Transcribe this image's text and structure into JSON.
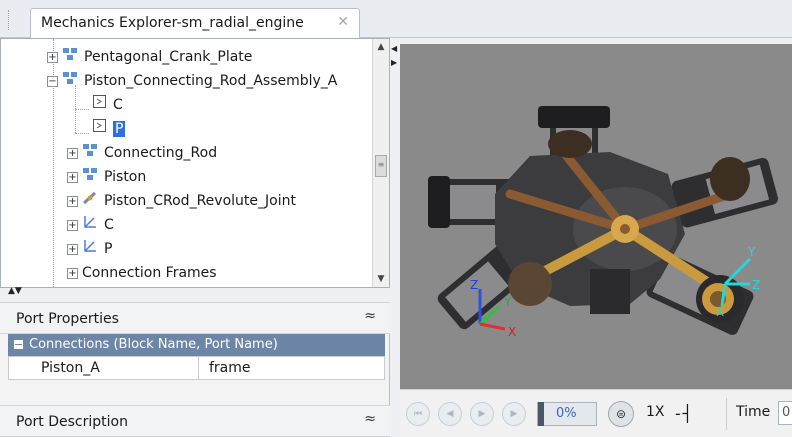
{
  "tab": {
    "title": "Mechanics Explorer-sm_radial_engine",
    "close_glyph": "✕"
  },
  "tree": {
    "items": [
      {
        "label": "Pentagonal_Crank_Plate",
        "icon": "subsystem-icon",
        "expander": "+"
      },
      {
        "label": "Piston_Connecting_Rod_Assembly_A",
        "icon": "subsystem-icon",
        "expander": "−"
      },
      {
        "label": "C",
        "icon": "port-icon",
        "expander": ""
      },
      {
        "label": "P",
        "icon": "port-icon",
        "expander": "",
        "selected": true
      },
      {
        "label": "Connecting_Rod",
        "icon": "subsystem-icon",
        "expander": "+"
      },
      {
        "label": "Piston",
        "icon": "subsystem-icon",
        "expander": "+"
      },
      {
        "label": "Piston_CRod_Revolute_Joint",
        "icon": "joint-icon",
        "expander": "+"
      },
      {
        "label": "C",
        "icon": "frame-icon",
        "expander": "+"
      },
      {
        "label": "P",
        "icon": "frame-icon",
        "expander": "+"
      },
      {
        "label": "Connection Frames",
        "icon": "",
        "expander": "+"
      }
    ]
  },
  "port_properties": {
    "title": "Port Properties",
    "collapse_glyph": "≈",
    "group_label": "Connections (Block Name, Port Name)",
    "row": {
      "name": "Piston_A",
      "value": "frame"
    }
  },
  "port_description": {
    "title": "Port Description",
    "expand_glyph": "≈"
  },
  "playback": {
    "buttons": [
      "skip-to-start",
      "step-back",
      "play",
      "step-forward"
    ],
    "progress_percent": 0,
    "progress_label": "0%",
    "speed": "1X",
    "time_label": "Time",
    "time_value": "0"
  },
  "viewer": {
    "background": "#8a8a8a",
    "triad_left": {
      "x": "X",
      "y": "Y",
      "z": "Z"
    },
    "triad_right": {
      "x": "X",
      "y": "Y",
      "z": "Z"
    }
  },
  "colors": {
    "selection": "#2f6fe0",
    "group_header": "#6e86a6",
    "accent": "#3a66c4"
  }
}
